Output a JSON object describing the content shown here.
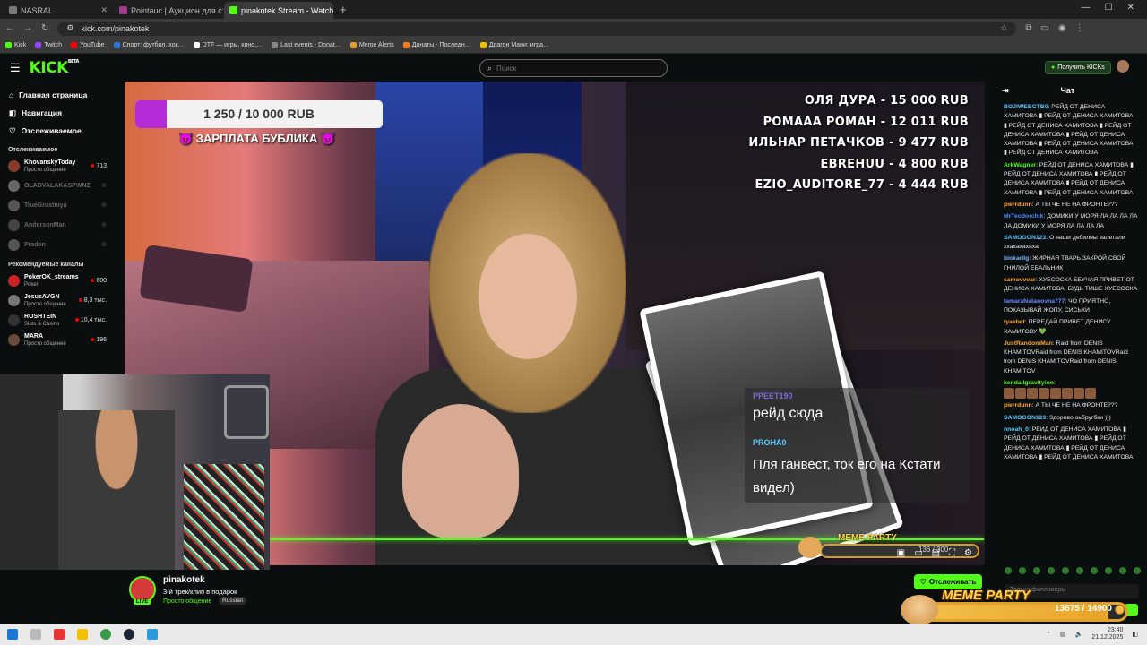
{
  "browser": {
    "tabs": [
      {
        "label": "NASRAL",
        "color": "#7a7a7a",
        "active": false
      },
      {
        "label": "Pointauc | Аукцион для стрим…",
        "color": "#a13a8a",
        "active": false
      },
      {
        "label": "pinakotek Stream - Watch",
        "color": "#53fc18",
        "active": true
      }
    ],
    "url": "kick.com/pinakotek",
    "bookmarks": [
      {
        "label": "Kick",
        "color": "#53fc18"
      },
      {
        "label": "Twitch",
        "color": "#9146ff"
      },
      {
        "label": "YouTube",
        "color": "#ff0000"
      },
      {
        "label": "Спорт: футбол, хок…",
        "color": "#2a7ad9"
      },
      {
        "label": "DTF — игры, кино,…",
        "color": "#ffffff"
      },
      {
        "label": "Last events - Donat…",
        "color": "#888888"
      },
      {
        "label": "Meme Alerts",
        "color": "#e0a02a"
      },
      {
        "label": "Донаты - Последн…",
        "color": "#ff7a1a"
      },
      {
        "label": "Драгон Мани: игра…",
        "color": "#f2c200"
      }
    ]
  },
  "header": {
    "logo": "KICK",
    "logo_beta": "BETA",
    "search_placeholder": "Поиск",
    "kicks_button": "Получить KICKs"
  },
  "sidebar": {
    "nav": [
      "Главная страница",
      "Навигация",
      "Отслеживаемое"
    ],
    "followed_title": "Отслеживаемое",
    "followed": [
      {
        "name": "KhovanskyToday",
        "sub": "Просто общение",
        "count": "713",
        "online": true,
        "color": "#8a3a2a"
      },
      {
        "name": "OLADVALAKASPWNZ",
        "sub": "",
        "count": "",
        "online": false,
        "color": "#666"
      },
      {
        "name": "TrueGrustniya",
        "sub": "",
        "count": "",
        "online": false,
        "color": "#555"
      },
      {
        "name": "AndersonMan",
        "sub": "",
        "count": "",
        "online": false,
        "color": "#444"
      },
      {
        "name": "Praden",
        "sub": "",
        "count": "",
        "online": false,
        "color": "#555"
      }
    ],
    "recommended_title": "Рекомендуемые каналы",
    "recommended": [
      {
        "name": "PokerOK_streams",
        "sub": "Poker",
        "count": "600",
        "color": "#c22"
      },
      {
        "name": "JesusAVGN",
        "sub": "Просто общение",
        "count": "8,3 тыс.",
        "color": "#777"
      },
      {
        "name": "ROSHTEIN",
        "sub": "Slots & Casino",
        "count": "10,4 тыс.",
        "color": "#333"
      },
      {
        "name": "MARA",
        "sub": "Просто общение",
        "count": "196",
        "color": "#6a4a3a"
      }
    ]
  },
  "overlay": {
    "donation_goal": "1 250 / 10 000 RUB",
    "donation_fraction": 0.125,
    "goal_title": "😈 ЗАРПЛАТА БУБЛИКА 😈",
    "top_donors": [
      "ОЛЯ ДУРА - 15 000 RUB",
      "РОМААА РОМАН - 12 011 RUB",
      "ИЛЬНАР ПЕТАЧКОВ - 9 477 RUB",
      "EBREHUU - 4 800 RUB",
      "EZIO_AUDITORE_77 - 4 444 RUB"
    ],
    "chat_user1": "PPEET190",
    "chat_msg1": "рейд сюда",
    "chat_user2": "PROHA0",
    "chat_msg2": "Пля ганвест, ток его на Кстати видел)",
    "meme_small_label": "MEME PARTY",
    "meme_small_count": "136 / 300"
  },
  "stream": {
    "name": "pinakotek",
    "live": "LIVE",
    "title": "3-й трек/клип в подарок",
    "category": "Просто общение",
    "language": "Russian",
    "follow_button": "Отслеживать"
  },
  "chat": {
    "title": "Чат",
    "messages": [
      {
        "user": "BOJIWEBCTB0",
        "color": "#5ac8ff",
        "text": "РЕЙД ОТ ДЕНИСА ХАМИТОВА ▮ РЕЙД ОТ ДЕНИСА ХАМИТОВА ▮ РЕЙД ОТ ДЕНИСА ХАМИТОВА ▮ РЕЙД ОТ ДЕНИСА ХАМИТОВА ▮ РЕЙД ОТ ДЕНИСА ХАМИТОВА ▮ РЕЙД ОТ ДЕНИСА ХАМИТОВА ▮ РЕЙД ОТ ДЕНИСА ХАМИТОВА"
      },
      {
        "user": "ArkWagner",
        "color": "#53fc18",
        "text": "РЕЙД ОТ ДЕНИСА ХАМИТОВА ▮ РЕЙД ОТ ДЕНИСА ХАМИТОВА ▮ РЕЙД ОТ ДЕНИСА ХАМИТОВА ▮ РЕЙД ОТ ДЕНИСА ХАМИТОВА ▮ РЕЙД ОТ ДЕНИСА ХАМИТОВА"
      },
      {
        "user": "pierrdunn",
        "color": "#ffa53a",
        "text": "А ТЫ ЧЕ НЕ НА ФРОНТЕ???"
      },
      {
        "user": "MrTeodorchik",
        "color": "#4a8aff",
        "text": "ДОМИКИ У МОРЯ ЛА ЛА ЛА ЛА ЛА ДОМИКИ У МОРЯ ЛА ЛА ЛА ЛА"
      },
      {
        "user": "SAMOGON123",
        "color": "#5ac8ff",
        "text": "О наши дебилны залетали ххахахахаха"
      },
      {
        "user": "biokarilg",
        "color": "#7ab8ff",
        "text": "ЖИРНАЯ ТВАРЬ ЗАКРОЙ СВОЙ ГНИЛОЙ ЕБАЛЬНИК"
      },
      {
        "user": "samovvvar",
        "color": "#ffa53a",
        "text": "ХУЕСОСКА ЕБУЧАЯ ПРИВЕТ ОТ ДЕНИСА ХАМИТОВА, БУДЬ ТИШЕ ХУЕСОСКА"
      },
      {
        "user": "tamaraNatanovna777",
        "color": "#6a8aff",
        "text": "ЧО ПРИЯТНО, ПОКАЗЫВАЙ ЖОПУ, СИСЬКИ"
      },
      {
        "user": "tyaebet",
        "color": "#ffa53a",
        "text": "ПЕРЕДАЙ ПРИВЕТ ДЕНИСУ ХАМИТОВУ 💚"
      },
      {
        "user": "JustRandomMan",
        "color": "#ffa53a",
        "text": "Raid from DENIS KHAMITOVRaid from DENIS KHAMITOVRaid from DENIS KHAMITOVRaid from DENIS KHAMITOV"
      },
      {
        "user": "kendallgravityion",
        "color": "#53fc18",
        "text": ""
      },
      {
        "user": "pierrdunn",
        "color": "#ffa53a",
        "text": "А ТЫ ЧЕ НЕ НА ФРОНТЕ???"
      },
      {
        "user": "SAMOGON123",
        "color": "#5ac8ff",
        "text": "Здорово оьбругбки )))"
      },
      {
        "user": "nnoah_0",
        "color": "#5ac8ff",
        "text": "РЕЙД ОТ ДЕНИСА ХАМИТОВА ▮ РЕЙД ОТ ДЕНИСА ХАМИТОВА ▮ РЕЙД ОТ ДЕНИСА ХАМИТОВА ▮ РЕЙД ОТ ДЕНИСА ХАМИТОВА ▮ РЕЙД ОТ ДЕНИСА ХАМИТОВА"
      }
    ],
    "input_placeholder": "Только фолловеры"
  },
  "meme_party": {
    "label": "MEME PARTY",
    "count": "13675 / 14900",
    "fraction": 0.918
  },
  "taskbar": {
    "time": "23:40",
    "date": "21.12.2025"
  }
}
